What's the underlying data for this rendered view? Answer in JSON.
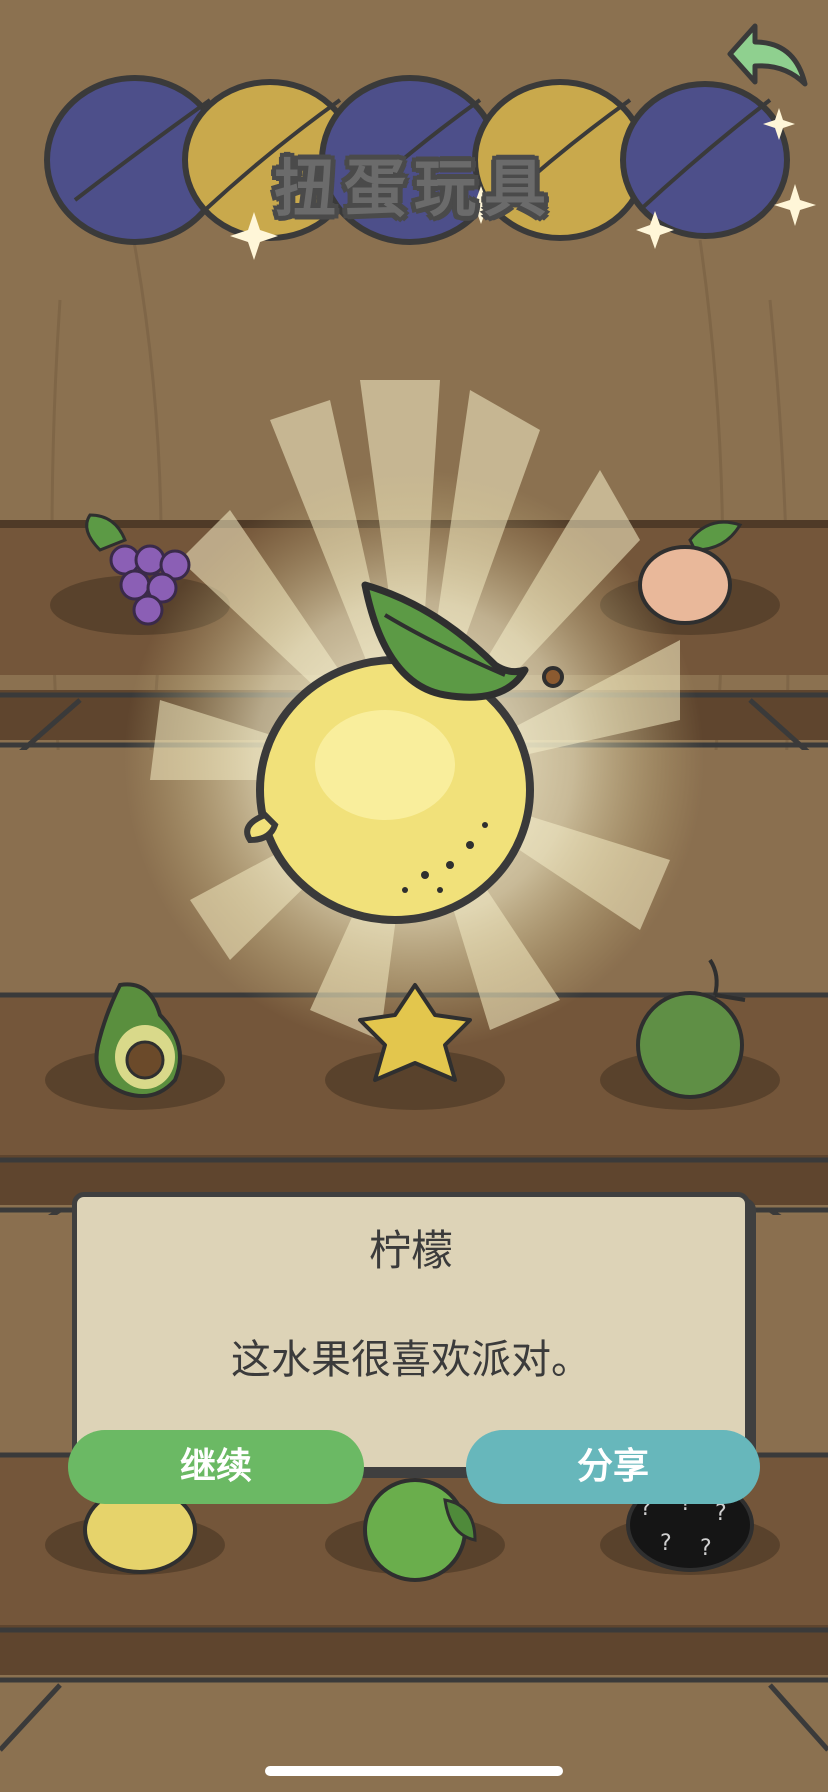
{
  "header": {
    "title": "扭蛋玩具",
    "back_icon": "back-arrow-icon"
  },
  "shelf_items": [
    {
      "name": "grape",
      "icon": "grape-icon",
      "shelf": 1
    },
    {
      "name": "peach",
      "icon": "peach-icon",
      "shelf": 1
    },
    {
      "name": "avocado",
      "icon": "avocado-icon",
      "shelf": 2
    },
    {
      "name": "starfruit",
      "icon": "starfruit-icon",
      "shelf": 2
    },
    {
      "name": "coconut",
      "icon": "coconut-icon",
      "shelf": 2
    },
    {
      "name": "lemon",
      "icon": "lemon-icon",
      "shelf": 3
    },
    {
      "name": "lime",
      "icon": "lime-icon",
      "shelf": 3
    },
    {
      "name": "unknown",
      "icon": "mystery-fruit-icon",
      "shelf": 3
    }
  ],
  "reward": {
    "icon": "lemon-icon"
  },
  "dialog": {
    "title": "柠檬",
    "description": "这水果很喜欢派对。"
  },
  "buttons": {
    "continue_label": "继续",
    "share_label": "分享"
  },
  "colors": {
    "continue": "#6bb964",
    "share": "#67b7bb",
    "dialog_bg": "#ddd3b7",
    "wood": "#8a6f4f"
  }
}
